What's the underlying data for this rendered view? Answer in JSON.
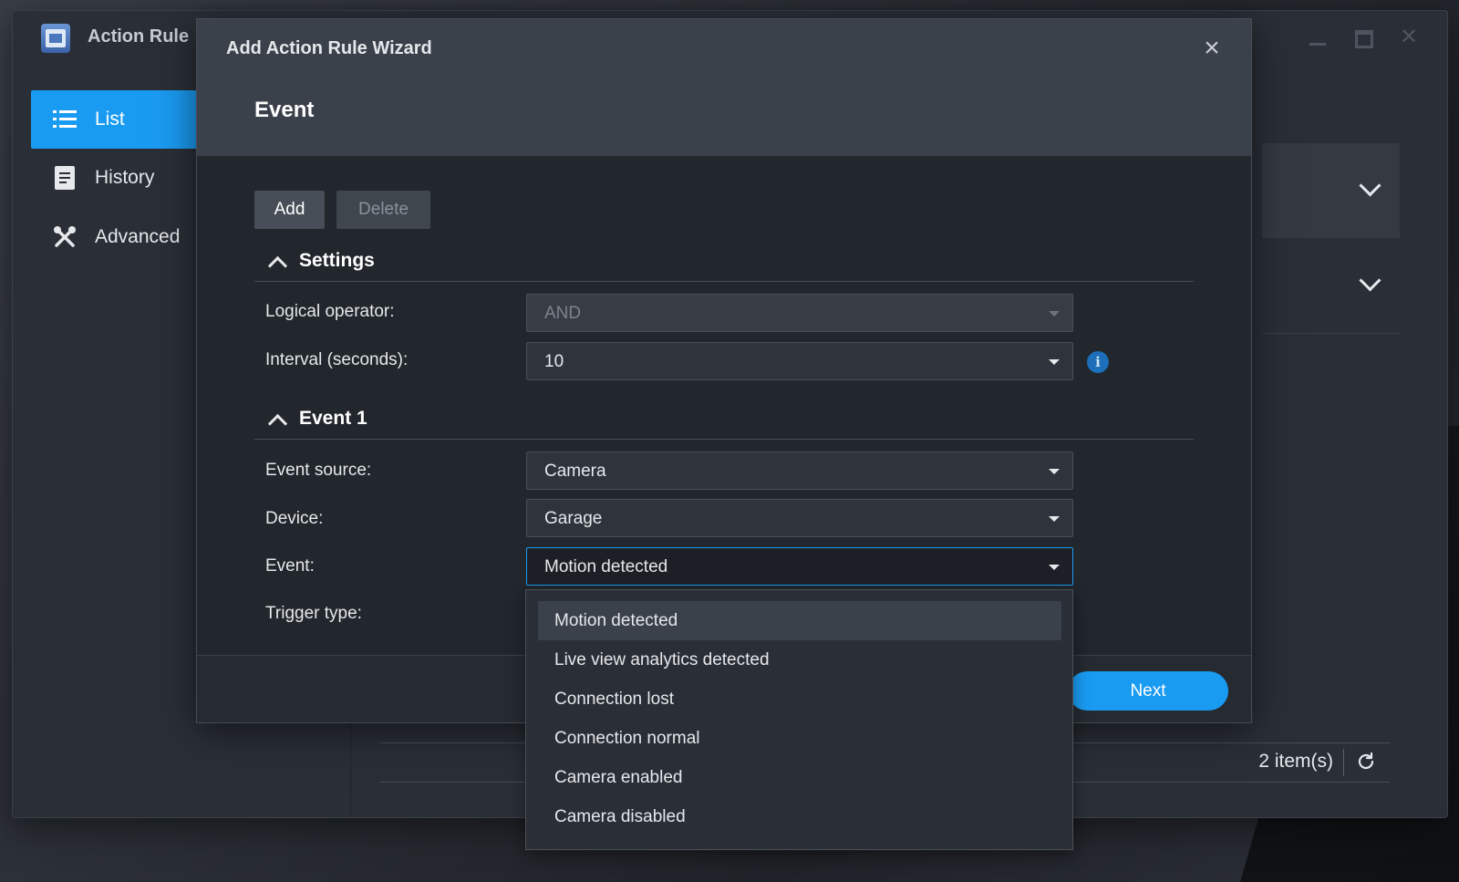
{
  "app": {
    "title": "Action Rule"
  },
  "sidebar": {
    "items": [
      {
        "label": "List",
        "icon": "list-icon",
        "active": true
      },
      {
        "label": "History",
        "icon": "history-icon",
        "active": false
      },
      {
        "label": "Advanced",
        "icon": "tools-icon",
        "active": false
      }
    ]
  },
  "main": {
    "item_count": "2 item(s)"
  },
  "wizard": {
    "title": "Add Action Rule Wizard",
    "step": "Event",
    "add_label": "Add",
    "delete_label": "Delete",
    "next_label": "Next",
    "settings": {
      "heading": "Settings",
      "logical_operator_label": "Logical operator:",
      "logical_operator_value": "AND",
      "interval_label": "Interval (seconds):",
      "interval_value": "10",
      "info_glyph": "i"
    },
    "event1": {
      "heading": "Event 1",
      "source_label": "Event source:",
      "source_value": "Camera",
      "device_label": "Device:",
      "device_value": "Garage",
      "event_label": "Event:",
      "event_value": "Motion detected",
      "trigger_label": "Trigger type:"
    },
    "event_options": [
      "Motion detected",
      "Live view analytics detected",
      "Connection lost",
      "Connection normal",
      "Camera enabled",
      "Camera disabled"
    ]
  },
  "colors": {
    "accent": "#1a9bf2",
    "dialog_bg": "#22262d",
    "header_bg": "#3b414a"
  }
}
